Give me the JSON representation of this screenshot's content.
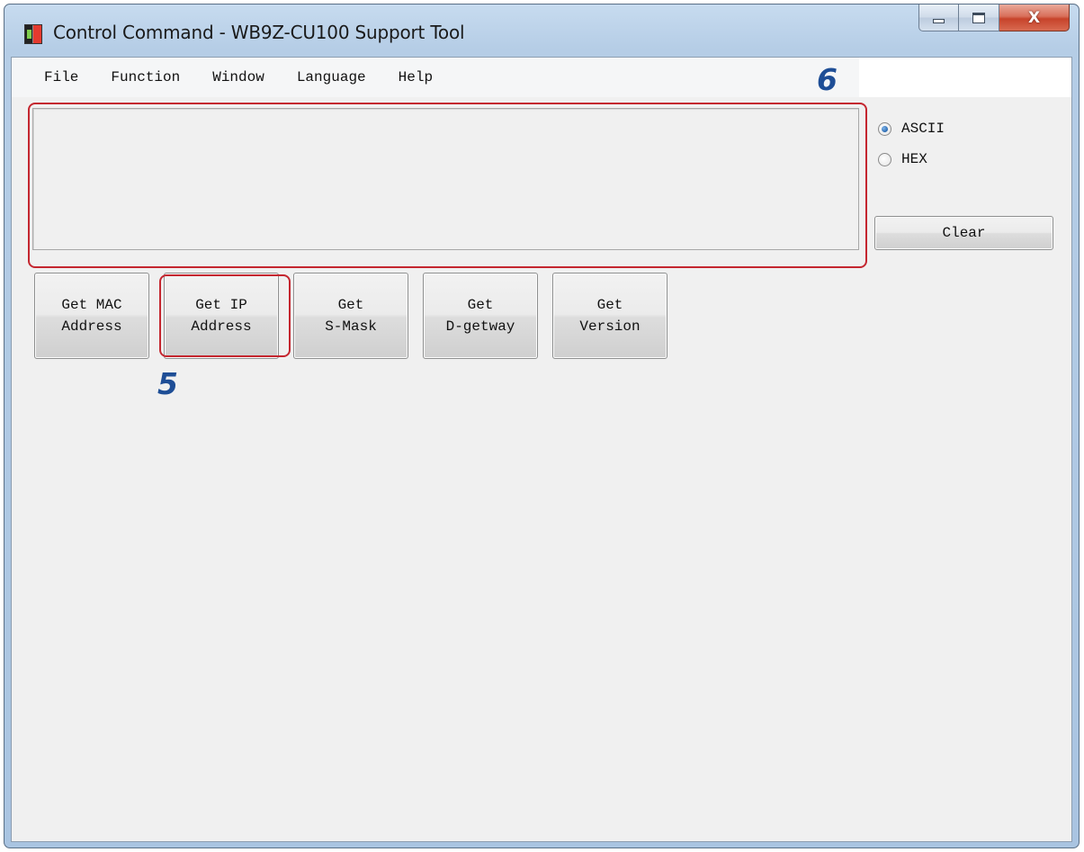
{
  "window": {
    "title": "Control Command - WB9Z-CU100 Support Tool",
    "close_glyph": "X"
  },
  "icons": {
    "app": "app-icon",
    "minimize": "minimize-icon",
    "maximize": "maximize-icon",
    "close": "close-icon"
  },
  "menu": [
    {
      "label": "File"
    },
    {
      "label": "Function"
    },
    {
      "label": "Window"
    },
    {
      "label": "Language"
    },
    {
      "label": "Help"
    }
  ],
  "output": {
    "value": ""
  },
  "format": {
    "options": [
      "ASCII",
      "HEX"
    ],
    "selected": "ASCII"
  },
  "clear_label": "Clear",
  "commands": [
    {
      "label": "Get MAC\nAddress"
    },
    {
      "label": "Get IP\nAddress"
    },
    {
      "label": "Get\nS-Mask"
    },
    {
      "label": "Get\nD-getway"
    },
    {
      "label": "Get\nVersion"
    }
  ],
  "callouts": {
    "output_area": "6",
    "get_ip_button": "5"
  },
  "colors": {
    "callout_frame": "#c4262f",
    "callout_number": "#1e4e96",
    "radio_selected": "#1e5fa8"
  }
}
